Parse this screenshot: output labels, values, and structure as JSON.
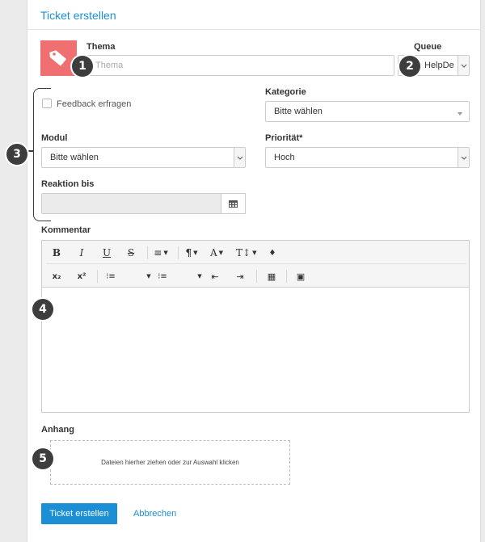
{
  "form": {
    "title": "Ticket erstellen"
  },
  "thema": {
    "label": "Thema",
    "placeholder": "Thema"
  },
  "queue": {
    "label": "Queue",
    "value": "HelpDe"
  },
  "feedback": {
    "label": "Feedback erfragen"
  },
  "kategorie": {
    "label": "Kategorie",
    "value": "Bitte wählen"
  },
  "modul": {
    "label": "Modul",
    "value": "Bitte wählen"
  },
  "prioritaet": {
    "label": "Priorität*",
    "value": "Hoch"
  },
  "reaktion": {
    "label": "Reaktion bis",
    "value": ""
  },
  "kommentar": {
    "label": "Kommentar"
  },
  "toolbar": {
    "bold": "B",
    "italic": "I",
    "underline": "U",
    "strike": "S",
    "align": "≡",
    "paragraph": "¶",
    "font_color": "A",
    "font_size": "T↕",
    "ink": "♦",
    "subscript": "x₂",
    "superscript": "x²",
    "ordered_list": "⁝≡",
    "unordered_list": "⁝≡",
    "outdent": "⇤",
    "indent": "⇥",
    "table": "▦",
    "image": "▣"
  },
  "anhang": {
    "label": "Anhang",
    "dropzone": "Dateien hierher ziehen oder zur Auswahl klicken"
  },
  "actions": {
    "submit": "Ticket erstellen",
    "cancel": "Abbrechen"
  },
  "badges": [
    "1",
    "2",
    "3",
    "4",
    "5"
  ],
  "colors": {
    "accent": "#1a8fd6",
    "tag_tile": "#f07071",
    "badge": "#3d3d3d"
  }
}
